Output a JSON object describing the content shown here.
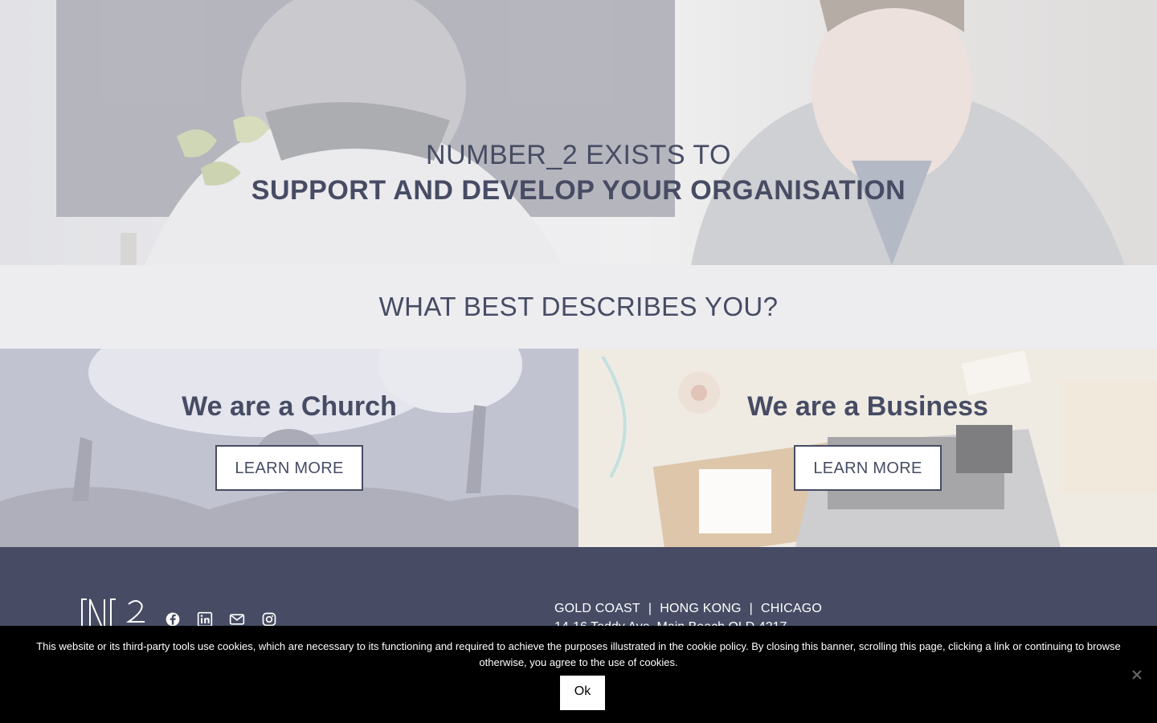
{
  "hero": {
    "line1": "NUMBER_2 EXISTS TO",
    "line2": "SUPPORT AND DEVELOP YOUR ORGANISATION"
  },
  "describes": {
    "title": "WHAT BEST DESCRIBES YOU?"
  },
  "cards": {
    "church": {
      "title": "We are a Church",
      "button": "LEARN MORE"
    },
    "business": {
      "title": "We are a Business",
      "button": "LEARN MORE"
    }
  },
  "footer": {
    "locations": [
      "GOLD COAST",
      "HONG KONG",
      "CHICAGO"
    ],
    "separator": "|",
    "address": "14-16 Teddy Ave, Main Beach QLD 4217",
    "socials": [
      "facebook-icon",
      "linkedin-icon",
      "mail-icon",
      "instagram-icon"
    ]
  },
  "cookie": {
    "text": "This website or its third-party tools use cookies, which are necessary to its functioning and required to achieve the purposes illustrated in the cookie policy. By closing this banner, scrolling this page, clicking a link or continuing to browse otherwise, you agree to the use of cookies.",
    "ok": "Ok"
  },
  "colors": {
    "primary": "#474c64",
    "footer_bg": "#474c64",
    "band_bg": "#ededf0",
    "cookie_bg": "#000000"
  }
}
